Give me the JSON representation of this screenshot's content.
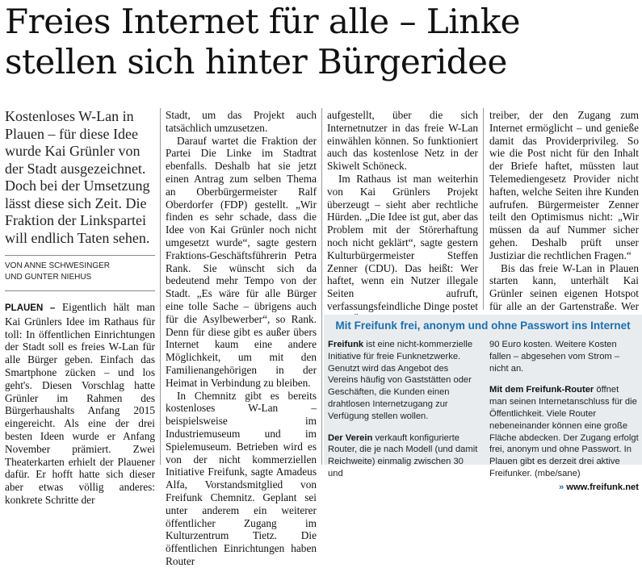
{
  "article": {
    "headline_line1": "Freies Internet für alle – Linke",
    "headline_line2": "stellen sich hinter Bürgeridee",
    "teaser": "Kostenloses W-Lan in Plauen – für diese Idee wurde Kai Grünler von der Stadt ausgezeichnet. Doch bei der Umsetzung lässt diese sich Zeit. Die Fraktion der Linkspartei will endlich Taten sehen.",
    "author_line1": "VON ANNE SCHWESINGER",
    "author_line2": "UND GUNTER NIEHUS",
    "dateline": "PLAUEN –",
    "col1_p1": "Eigentlich hält man Kai Grünlers Idee im Rathaus für toll: In öffentlichen Einrichtungen der Stadt soll es freies W-Lan für alle Bürger geben. Einfach das Smartphone zücken – und los geht's. Diesen Vorschlag hatte Grünler im Rahmen des Bürgerhaushalts Anfang 2015 eingereicht. Als eine der drei besten Ideen wurde er Anfang November prämiert. Zwei Theaterkarten erhielt der Plauener dafür. Er hofft hatte sich dieser aber etwas völlig anderes: konkrete Schritte der",
    "col2_p1": "Stadt, um das Projekt auch tatsächlich umzusetzen.",
    "col2_p2": "Darauf wartet die Fraktion der Partei Die Linke im Stadtrat ebenfalls. Deshalb hat sie jetzt einen Antrag zum selben Thema an Oberbürgermeister Ralf Oberdorfer (FDP) gestellt. „Wir finden es sehr schade, dass die Idee von Kai Grünler noch nicht umgesetzt wurde“, sagte gestern Fraktions-Geschäftsführerin Petra Rank. Sie wünscht sich da bedeutend mehr Tempo von der Stadt. „Es wäre für alle Bürger eine tolle Sache – übrigens auch für die Asylbewerber“, so Rank. Denn für diese gibt es außer übers Internet kaum eine andere Möglichkeit, um mit den Familienangehörigen in der Heimat in Verbindung zu bleiben.",
    "col2_p3": "In Chemnitz gibt es bereits kostenloses W-Lan – beispielsweise im Industriemuseum und im Spielemuseum. Betrieben wird es von der nicht kommerziellen Initiative Freifunk, sagte Amadeus Alfa, Vorstandsmitglied von Freifunk Chemnitz. Geplant sei unter anderem ein weiterer öffentlicher Zugang im Kulturzentrum Tietz. Die öffentlichen Einrichtungen haben Router",
    "col3_p1": "aufgestellt, über die sich Internetnutzer in das freie W-Lan einwählen können. So funktioniert auch das kostenlose Netz in der Skiwelt Schöneck.",
    "col3_p2": "Im Rathaus ist man weiterhin von Kai Grünlers Projekt überzeugt – sieht aber rechtliche Hürden. „Die Idee ist gut, aber das Problem mit der Störerhaftung noch nicht geklärt“, sagte gestern Kulturbürgermeister Steffen Zenner (CDU). Das heißt: Wer haftet, wenn ein Nutzer illegale Seiten aufruft, verfassungsfeindliche Dinge postet oder Ähnliches? Für Grünler ist dies eindeutig: Freifunk gelte als Provider – also als Be-",
    "col4_p1": "treiber, der den Zugang zum Internet ermöglicht – und genieße damit das Providerprivileg. So wie die Post nicht für den Inhalt der Briefe haftet, müssten laut Telemediengesetz Provider nicht haften, welche Seiten ihre Kunden aufrufen. Bürgermeister Zenner teilt den Optimismus nicht: „Wir müssen da auf Nummer sicher gehen. Deshalb prüft unser Justiziar die rechtlichen Fragen.“",
    "col4_p2": "Bis das freie W-Lan in Plauen starten kann, unterhält Kai Grünler seinen eigenen Hotspot für alle an der Gartenstraße. Wer dort vorbeikommt, kann gratis den Internetzugang nutzen."
  },
  "infobox": {
    "title": "Mit Freifunk frei, anonym und ohne Passwort ins Internet",
    "p1_lead": "Freifunk",
    "p1_text": " ist eine nicht-kommerzielle Initiative für freie Funknetzwerke. Genutzt wird das Angebot des Vereins häufig von Gaststätten oder Geschäften, die Kunden einen drahtlosen Internetzugang zur Verfügung stellen wollen.",
    "p2_lead": "Der Verein",
    "p2_text": " verkauft konfigurierte Router, die je nach Modell (und damit Reichweite) einmalig zwischen 30 und",
    "p3_text": "90 Euro kosten. Weitere Kosten fallen – abgesehen vom Strom – nicht an.",
    "p4_lead": "Mit dem Freifunk-Router",
    "p4_text": " öffnet man seinen Internetanschluss für die Öffentlichkeit. Viele Router nebeneinander können eine große Fläche abdecken. Der Zugang erfolgt frei, anonym und ohne Passwort. In Plauen gibt es derzeit drei aktive Freifunker. (mbe/sane)",
    "link_arrow": "»",
    "link_text": " www.freifunk.net"
  }
}
